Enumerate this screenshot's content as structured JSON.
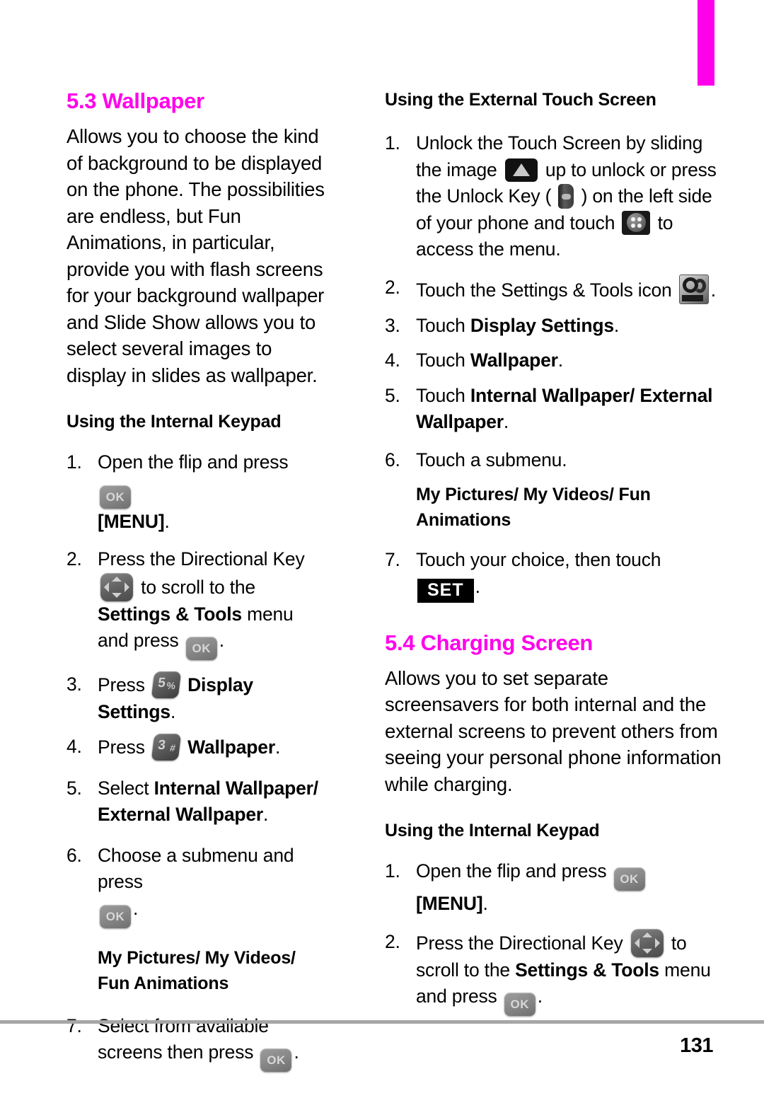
{
  "page": {
    "number": "131",
    "tab_color": "#ff00ea"
  },
  "left_column": {
    "section_heading": "5.3 Wallpaper",
    "intro_paragraph": "Allows you to choose the kind of background to be displayed on the phone. The possibilities are endless, but Fun Animations, in particular, provide you with flash screens for your background wallpaper and Slide Show allows you to select several images to display in slides as wallpaper.",
    "sub_heading": "Using the Internal Keypad",
    "steps": [
      {
        "num": "1.",
        "text_before": "Open the flip and press",
        "icon": "ok-key-icon",
        "text_after": "",
        "bold_after": "[MENU]",
        "trailing": "."
      },
      {
        "num": "2.",
        "text_before": "Press the Directional Key",
        "icon": "directional-key-icon",
        "text_after": "to scroll to the",
        "bold_mid": "Settings & Tools",
        "text_mid2": "menu and press",
        "icon2": "ok-key-icon",
        "trailing": "."
      },
      {
        "num": "3.",
        "text_before": "Press",
        "icon": "key-5-icon",
        "key_digit": "5",
        "key_symbol": "%",
        "bold_after": "Display Settings",
        "trailing": "."
      },
      {
        "num": "4.",
        "text_before": "Press",
        "icon": "key-3-icon",
        "key_digit": "3",
        "key_symbol": "#",
        "bold_after": "Wallpaper",
        "trailing": "."
      },
      {
        "num": "5.",
        "text_before": "Select",
        "bold_after": "Internal Wallpaper/ External Wallpaper",
        "trailing": "."
      },
      {
        "num": "6.",
        "text_before": "Choose a submenu and press",
        "icon": "ok-key-icon",
        "trailing": "."
      },
      {
        "num": "7.",
        "text_before": "Select from available screens then press",
        "icon": "ok-key-icon",
        "trailing": "."
      }
    ],
    "submenu_note": "My Pictures/ My Videos/ Fun Animations"
  },
  "right_column": {
    "sub_heading_touch": "Using the External Touch Screen",
    "touch_steps": [
      {
        "num": "1.",
        "part1": "Unlock the Touch Screen by sliding the image",
        "icon1": "slide-up-arrow-icon",
        "part2": "up to unlock or press the Unlock Key (",
        "icon2": "unlock-key-icon",
        "part3": ") on the left side of your phone and touch",
        "icon3": "menu-grid-icon",
        "part4": "to access the menu."
      },
      {
        "num": "2.",
        "part1": "Touch the Settings & Tools icon",
        "icon1": "settings-and-tools-icon",
        "part2": "."
      },
      {
        "num": "3.",
        "part1": "Touch",
        "bold": "Display Settings",
        "part2": "."
      },
      {
        "num": "4.",
        "part1": "Touch",
        "bold": "Wallpaper",
        "part2": "."
      },
      {
        "num": "5.",
        "part1": "Touch",
        "bold": "Internal Wallpaper/ External Wallpaper",
        "part2": "."
      },
      {
        "num": "6.",
        "part1": "Touch a submenu.",
        "bold": "",
        "part2": ""
      },
      {
        "num": "7.",
        "part1": "Touch your choice, then touch",
        "button": "SET",
        "part2": "."
      }
    ],
    "submenu_note": "My Pictures/ My Videos/ Fun Animations",
    "section_heading": "5.4 Charging Screen",
    "intro_paragraph": "Allows you to set separate screensavers for both internal and the external screens to prevent others from seeing your personal phone information while charging.",
    "sub_heading_keypad": "Using the Internal Keypad",
    "keypad_steps": [
      {
        "num": "1.",
        "text_before": "Open the flip and press",
        "icon": "ok-key-icon",
        "bold_after": "[MENU]",
        "trailing": "."
      },
      {
        "num": "2.",
        "text_before": "Press the Directional Key",
        "icon": "directional-key-icon",
        "text_after": "to scroll to the",
        "bold_mid": "Settings & Tools",
        "text_mid2": "menu and press",
        "icon2": "ok-key-icon",
        "trailing": "."
      }
    ]
  }
}
